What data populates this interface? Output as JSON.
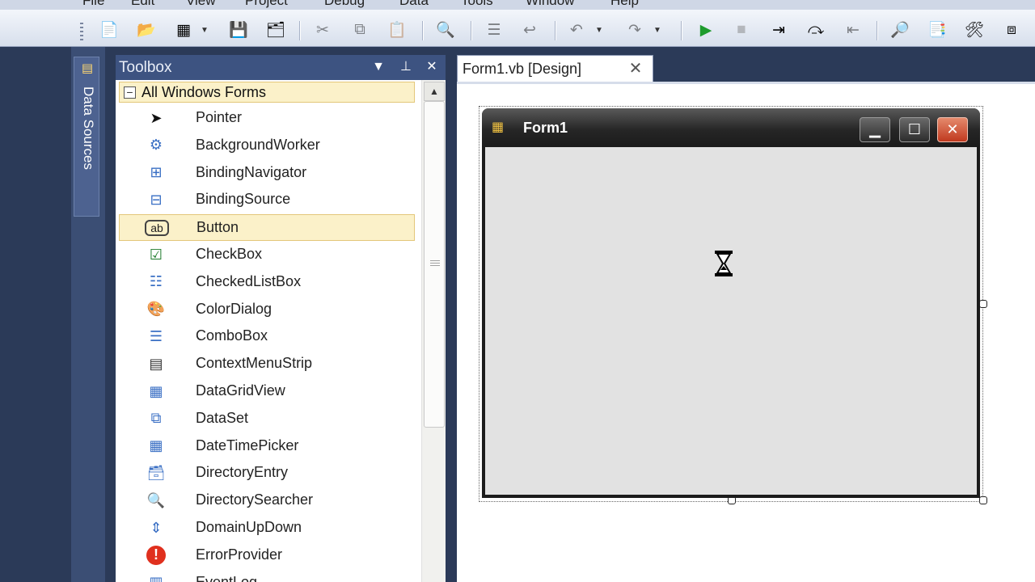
{
  "menu": [
    "File",
    "Edit",
    "View",
    "Project",
    "Debug",
    "Data",
    "Tools",
    "Window",
    "Help"
  ],
  "toolbar": {
    "buttons": [
      {
        "name": "add-new-item-icon",
        "glyph": "📄"
      },
      {
        "name": "open-file-icon",
        "glyph": "📂"
      },
      {
        "name": "add-item-icon",
        "glyph": "▦"
      },
      {
        "name": "save-icon",
        "glyph": "💾"
      },
      {
        "name": "save-all-icon",
        "glyph": "🗂"
      },
      {
        "name": "cut-icon",
        "glyph": "✂"
      },
      {
        "name": "copy-icon",
        "glyph": "⧉"
      },
      {
        "name": "paste-icon",
        "glyph": "📋"
      },
      {
        "name": "find-icon",
        "glyph": "🔍"
      },
      {
        "name": "comment-icon",
        "glyph": "☰"
      },
      {
        "name": "uncomment-icon",
        "glyph": "↩"
      },
      {
        "name": "undo-icon",
        "glyph": "↶"
      },
      {
        "name": "redo-icon",
        "glyph": "↷"
      },
      {
        "name": "start-debug-icon",
        "glyph": "▶"
      },
      {
        "name": "stop-debug-icon",
        "glyph": "■"
      },
      {
        "name": "step-into-icon",
        "glyph": "⇥"
      },
      {
        "name": "step-over-icon",
        "glyph": "⤼"
      },
      {
        "name": "step-out-icon",
        "glyph": "⇤"
      },
      {
        "name": "find-symbol-icon",
        "glyph": "🔎"
      },
      {
        "name": "properties-icon",
        "glyph": "📑"
      },
      {
        "name": "tools-icon",
        "glyph": "🛠"
      },
      {
        "name": "class-view-icon",
        "glyph": "⧈"
      }
    ]
  },
  "sidebar": {
    "data_sources_label": "Data Sources"
  },
  "toolbox": {
    "title": "Toolbox",
    "group_label": "All Windows Forms",
    "group_symbol": "−",
    "items": [
      {
        "label": "Pointer",
        "icon": "pointer-icon",
        "glyph": "➤"
      },
      {
        "label": "BackgroundWorker",
        "icon": "background-worker-icon",
        "glyph": "⚙"
      },
      {
        "label": "BindingNavigator",
        "icon": "binding-navigator-icon",
        "glyph": "⊞"
      },
      {
        "label": "BindingSource",
        "icon": "binding-source-icon",
        "glyph": "⊟"
      },
      {
        "label": "Button",
        "icon": "button-icon",
        "glyph": "ab"
      },
      {
        "label": "CheckBox",
        "icon": "checkbox-icon",
        "glyph": "☑"
      },
      {
        "label": "CheckedListBox",
        "icon": "checked-list-box-icon",
        "glyph": "☷"
      },
      {
        "label": "ColorDialog",
        "icon": "color-dialog-icon",
        "glyph": "🎨"
      },
      {
        "label": "ComboBox",
        "icon": "combo-box-icon",
        "glyph": "☰"
      },
      {
        "label": "ContextMenuStrip",
        "icon": "context-menu-strip-icon",
        "glyph": "▤"
      },
      {
        "label": "DataGridView",
        "icon": "data-grid-view-icon",
        "glyph": "▦"
      },
      {
        "label": "DataSet",
        "icon": "dataset-icon",
        "glyph": "⧉"
      },
      {
        "label": "DateTimePicker",
        "icon": "date-time-picker-icon",
        "glyph": "▦"
      },
      {
        "label": "DirectoryEntry",
        "icon": "directory-entry-icon",
        "glyph": "🗃"
      },
      {
        "label": "DirectorySearcher",
        "icon": "directory-searcher-icon",
        "glyph": "🔍"
      },
      {
        "label": "DomainUpDown",
        "icon": "domain-up-down-icon",
        "glyph": "⇕"
      },
      {
        "label": "ErrorProvider",
        "icon": "error-provider-icon",
        "glyph": "!"
      },
      {
        "label": "EventLog",
        "icon": "event-log-icon",
        "glyph": "▥"
      }
    ],
    "selected_index": 4
  },
  "document_tab": {
    "title": "Form1.vb [Design]",
    "close_glyph": "✕"
  },
  "form": {
    "title": "Form1",
    "minimize_glyph": "▁",
    "maximize_glyph": "☐",
    "close_glyph": "✕"
  },
  "colors": {
    "panel_title": "#3d5381",
    "selection": "#fbf1c9",
    "selection_border": "#e3c77a",
    "form_close": "#c0391f"
  }
}
